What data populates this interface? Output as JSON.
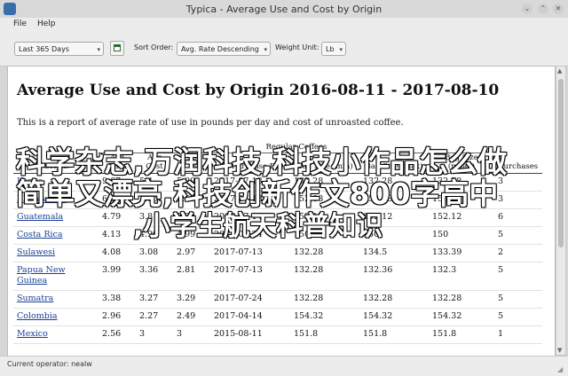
{
  "window": {
    "title": "Typica - Average Use and Cost by Origin",
    "buttons": {
      "minimize": "⌄",
      "maximize": "⌃",
      "close": "✕"
    }
  },
  "menu": {
    "items": [
      "File",
      "Help"
    ]
  },
  "toolbar": {
    "date_range": "Last 365 Days",
    "sort_label": "Sort Order:",
    "sort_value": "Avg. Rate Descending",
    "weight_label": "Weight Unit:",
    "weight_value": "Lb",
    "calendar_icon": "calendar-icon"
  },
  "report": {
    "title": "Average Use and Cost by Origin 2016-08-11 - 2017-08-10",
    "description": "This is a report of average rate of use in pounds per day and cost of unroasted coffee.",
    "group_header": "Regular Coffees",
    "columns": [
      "Origin",
      "Avg Rate",
      "Avg Cost",
      "Last Cost",
      "Last Purchase Date",
      "Bag Size (min)",
      "Bag Size (max)",
      "Bag Size (mean)",
      "Purchases"
    ],
    "rows": [
      [
        "Kenya",
        "9.67",
        "5.4",
        "5.99",
        "2017-07-13",
        "132.28",
        "132.28",
        "132.28",
        "3"
      ],
      [
        "El Salvador",
        "6.51",
        "3.55",
        "3.59",
        "2017-07-13",
        "152.08",
        "152.08",
        "152.08",
        "3"
      ],
      [
        "Guatemala",
        "4.79",
        "3.8",
        "3.32",
        "2017-07-14",
        "152.12",
        "152.12",
        "152.12",
        "6"
      ],
      [
        "Costa Rica",
        "4.13",
        "4.99",
        "4.99",
        "2017-07-24",
        "150",
        "150",
        "150",
        "5"
      ],
      [
        "Sulawesi",
        "4.08",
        "3.08",
        "2.97",
        "2017-07-13",
        "132.28",
        "134.5",
        "133.39",
        "2"
      ],
      [
        "Papua New Guinea",
        "3.99",
        "3.36",
        "2.81",
        "2017-07-13",
        "132.28",
        "132.36",
        "132.3",
        "5"
      ],
      [
        "Sumatra",
        "3.38",
        "3.27",
        "3.29",
        "2017-07-24",
        "132.28",
        "132.28",
        "132.28",
        "5"
      ],
      [
        "Colombia",
        "2.96",
        "2.27",
        "2.49",
        "2017-04-14",
        "154.32",
        "154.32",
        "154.32",
        "5"
      ],
      [
        "Mexico",
        "2.56",
        "3",
        "3",
        "2015-08-11",
        "151.8",
        "151.8",
        "151.8",
        "1"
      ]
    ]
  },
  "status": {
    "text": "Current operator: nealw"
  },
  "overlay": {
    "lines": [
      "科学杂志,万润科技,科技小作品怎么做",
      "简单又漂亮,科技创新作文800字高中",
      ",小学生航天科普知识"
    ],
    "color": "#ffffff"
  }
}
